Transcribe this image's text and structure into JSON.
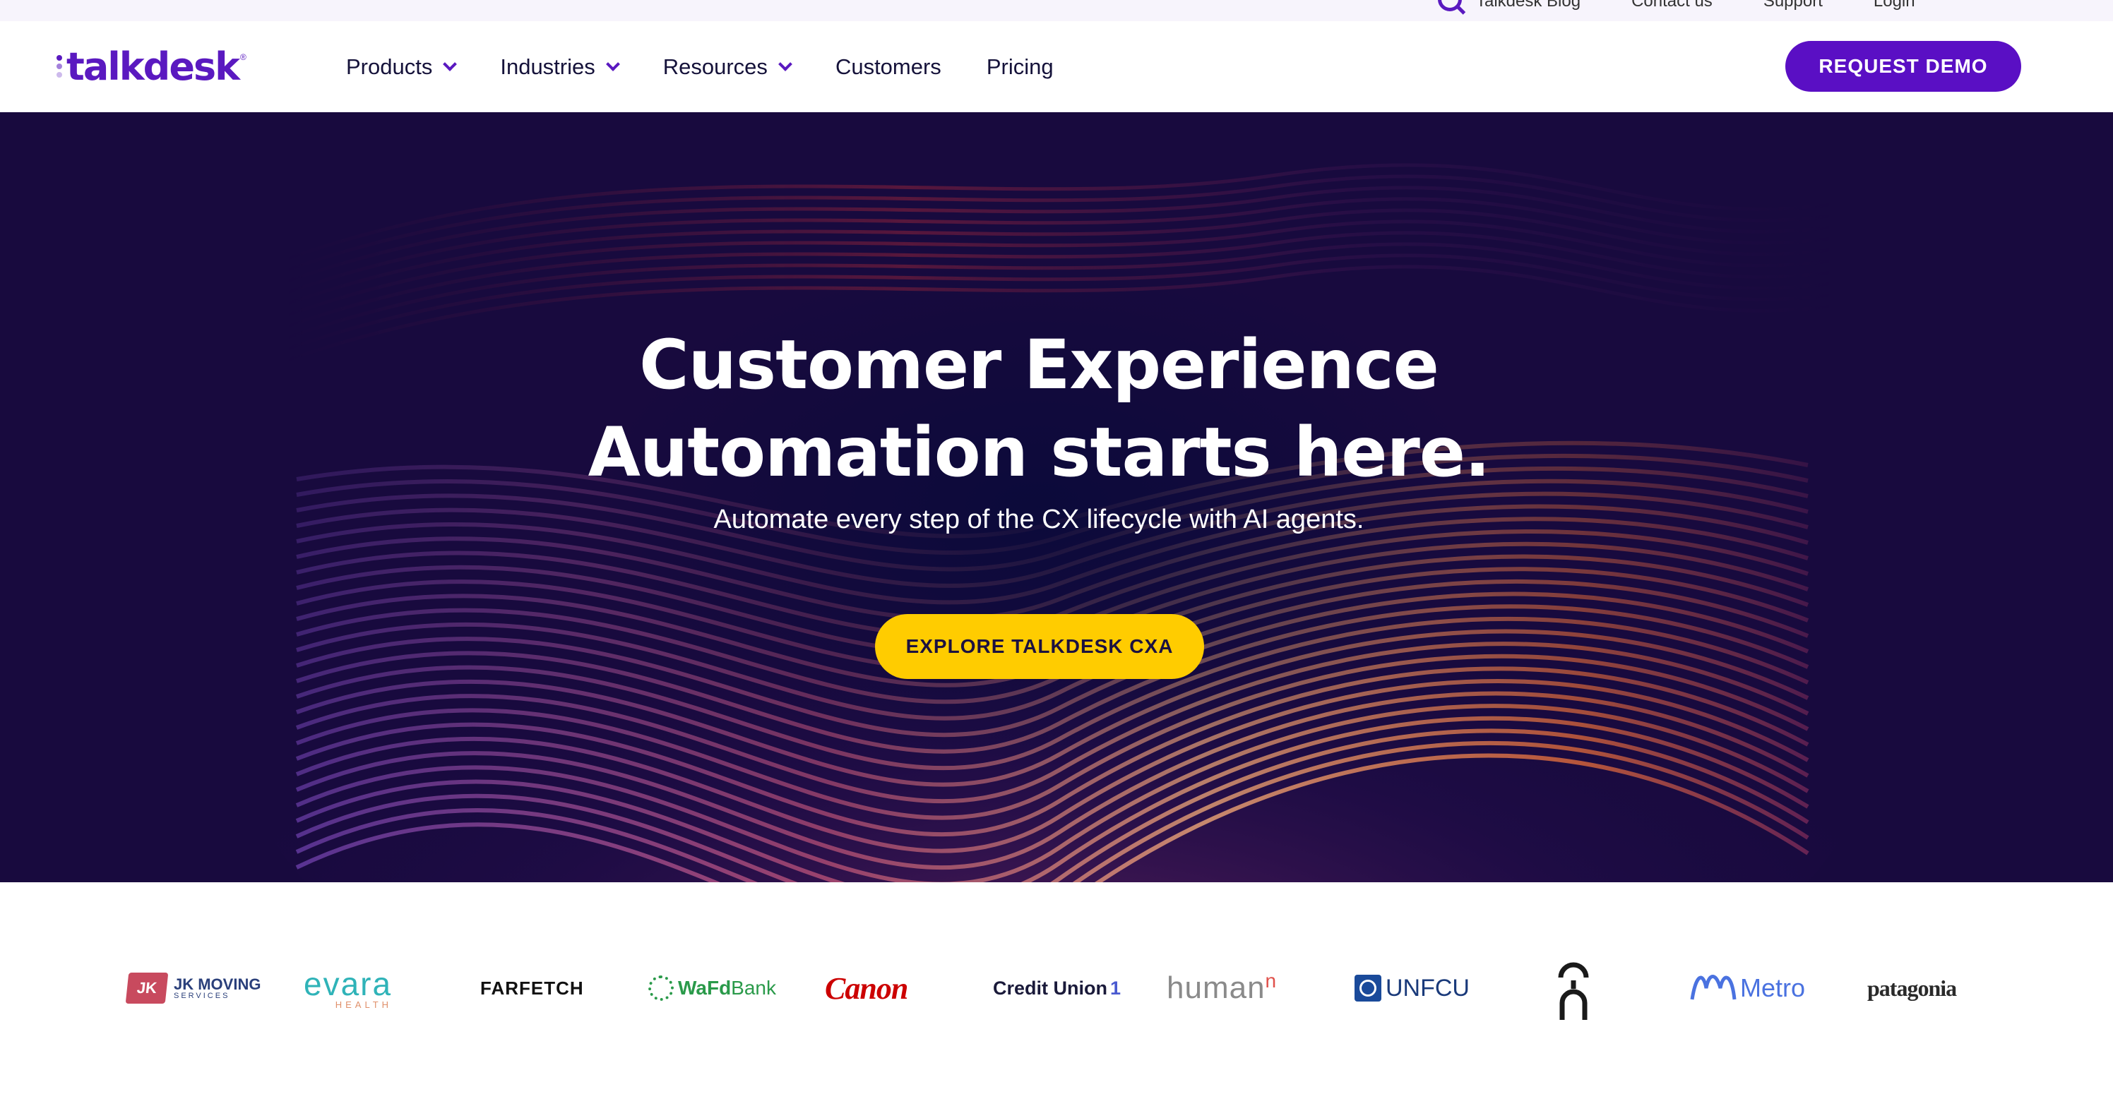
{
  "utility": {
    "links": [
      "Talkdesk Blog",
      "Contact us",
      "Support",
      "Login"
    ]
  },
  "brand": {
    "name": "talkdesk",
    "registered_mark": "®",
    "color": "#5a19c0"
  },
  "nav": {
    "items": [
      {
        "label": "Products",
        "dropdown": true
      },
      {
        "label": "Industries",
        "dropdown": true
      },
      {
        "label": "Resources",
        "dropdown": true
      },
      {
        "label": "Customers",
        "dropdown": false
      },
      {
        "label": "Pricing",
        "dropdown": false
      }
    ],
    "cta_label": "REQUEST DEMO",
    "cta_color": "#5a0fc4"
  },
  "hero": {
    "title_line1": "Customer Experience",
    "title_line2": "Automation starts here.",
    "subtitle": "Automate every step of the CX lifecycle with AI agents.",
    "cta_label": "EXPLORE TALKDESK CXA",
    "cta_color": "#ffcc00",
    "background_color": "#180a3e"
  },
  "clients": [
    {
      "name": "JK MOVING",
      "tagline": "SERVICES",
      "badge": "JK"
    },
    {
      "name": "evara",
      "tagline": "HEALTH"
    },
    {
      "name": "FARFETCH"
    },
    {
      "name": "WaFd Bank",
      "prefix": "WaFd",
      "suffix": "Bank"
    },
    {
      "name": "Canon"
    },
    {
      "name": "Credit Union 1",
      "prefix": "Credit Union",
      "suffix": "1"
    },
    {
      "name": "humann",
      "prefix": "human",
      "suffix": "n"
    },
    {
      "name": "UNFCU"
    },
    {
      "name": "On"
    },
    {
      "name": "Metro"
    },
    {
      "name": "patagonia"
    }
  ]
}
